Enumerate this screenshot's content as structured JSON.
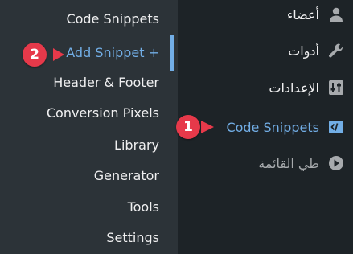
{
  "submenu": {
    "items": [
      {
        "label": "Code Snippets"
      },
      {
        "label": "Add Snippet +"
      },
      {
        "label": "Header & Footer"
      },
      {
        "label": "Conversion Pixels"
      },
      {
        "label": "Library"
      },
      {
        "label": "Generator"
      },
      {
        "label": "Tools"
      },
      {
        "label": "Settings"
      }
    ]
  },
  "mainmenu": {
    "items": [
      {
        "label": "أعضاء",
        "icon": "users-icon"
      },
      {
        "label": "أدوات",
        "icon": "wrench-icon"
      },
      {
        "label": "الإعدادات",
        "icon": "settings-sliders-icon"
      },
      {
        "label": "Code Snippets",
        "icon": "code-snippets-icon"
      },
      {
        "label": "طي القائمة",
        "icon": "collapse-menu-icon"
      }
    ]
  },
  "callouts": [
    {
      "number": "1"
    },
    {
      "number": "2"
    }
  ],
  "colors": {
    "menu_bg": "#1d2327",
    "submenu_bg": "#2c3338",
    "accent": "#72aee6",
    "callout": "#e6394a",
    "text": "#f0f0f1"
  }
}
